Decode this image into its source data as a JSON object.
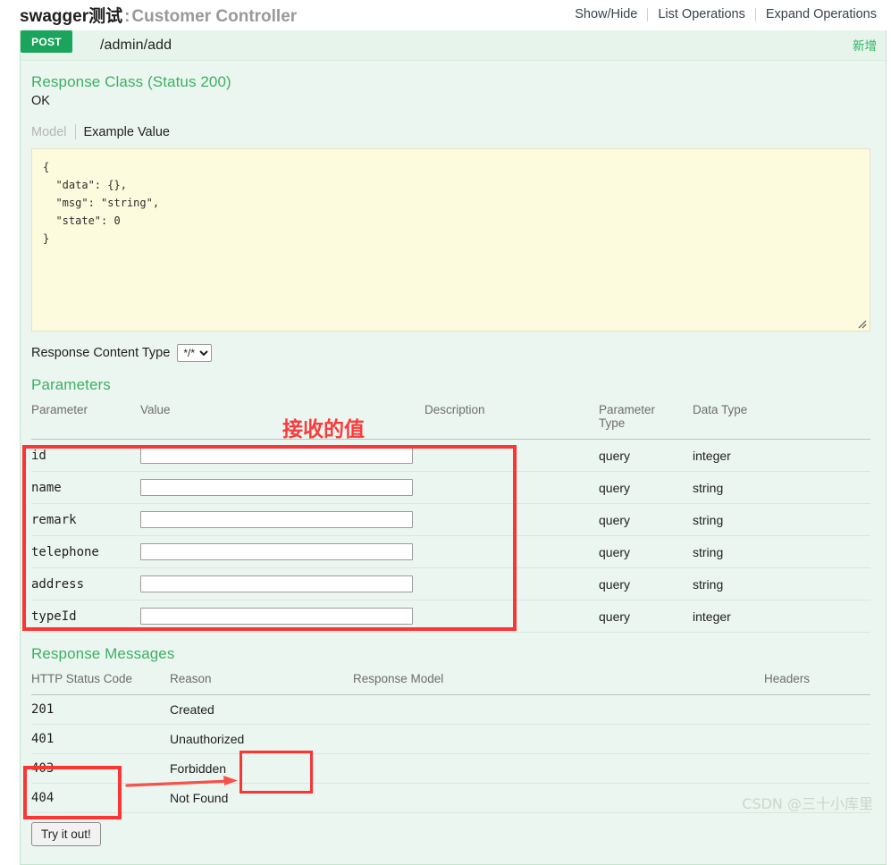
{
  "header": {
    "app_name": "swagger测试",
    "separator": ":",
    "controller": "Customer Controller",
    "options": [
      {
        "label": "Show/Hide"
      },
      {
        "label": "List Operations"
      },
      {
        "label": "Expand Operations"
      }
    ]
  },
  "operation": {
    "method": "POST",
    "path": "/admin/add",
    "summary": "新增"
  },
  "response_class": {
    "title": "Response Class (Status 200)",
    "status_text": "OK",
    "tabs": [
      {
        "label": "Model",
        "active": false
      },
      {
        "label": "Example Value",
        "active": true
      }
    ],
    "example_lines": [
      "{",
      "  \"data\": {},",
      "  \"msg\": \"string\",",
      "  \"state\": 0",
      "}"
    ],
    "example_value_raw": "{\n  \"data\": {},\n  \"msg\": \"string\",\n  \"state\": 0\n}"
  },
  "content_type": {
    "label": "Response Content Type",
    "selected": "*/*",
    "options": [
      "*/*"
    ]
  },
  "parameters": {
    "title": "Parameters",
    "columns": [
      "Parameter",
      "Value",
      "Description",
      "Parameter Type",
      "Data Type"
    ],
    "column_parameter_type_line1": "Parameter",
    "column_parameter_type_line2": "Type",
    "rows": [
      {
        "name": "id",
        "value": "",
        "description": "",
        "param_type": "query",
        "data_type": "integer"
      },
      {
        "name": "name",
        "value": "",
        "description": "",
        "param_type": "query",
        "data_type": "string"
      },
      {
        "name": "remark",
        "value": "",
        "description": "",
        "param_type": "query",
        "data_type": "string"
      },
      {
        "name": "telephone",
        "value": "",
        "description": "",
        "param_type": "query",
        "data_type": "string"
      },
      {
        "name": "address",
        "value": "",
        "description": "",
        "param_type": "query",
        "data_type": "string"
      },
      {
        "name": "typeId",
        "value": "",
        "description": "",
        "param_type": "query",
        "data_type": "integer"
      }
    ]
  },
  "response_messages": {
    "title": "Response Messages",
    "columns": [
      "HTTP Status Code",
      "Reason",
      "Response Model",
      "Headers"
    ],
    "rows": [
      {
        "code": "201",
        "reason": "Created",
        "model": "",
        "headers": ""
      },
      {
        "code": "401",
        "reason": "Unauthorized",
        "model": "",
        "headers": ""
      },
      {
        "code": "403",
        "reason": "Forbidden",
        "model": "",
        "headers": ""
      },
      {
        "code": "404",
        "reason": "Not Found",
        "model": "",
        "headers": ""
      }
    ]
  },
  "actions": {
    "try_it_out": "Try it out!"
  },
  "annotations": {
    "received_value_note": "接收的值",
    "note_color": "#fb3b3b",
    "highlight_color": "#fb3434"
  },
  "watermark": {
    "text": "CSDN @三十小库里"
  }
}
